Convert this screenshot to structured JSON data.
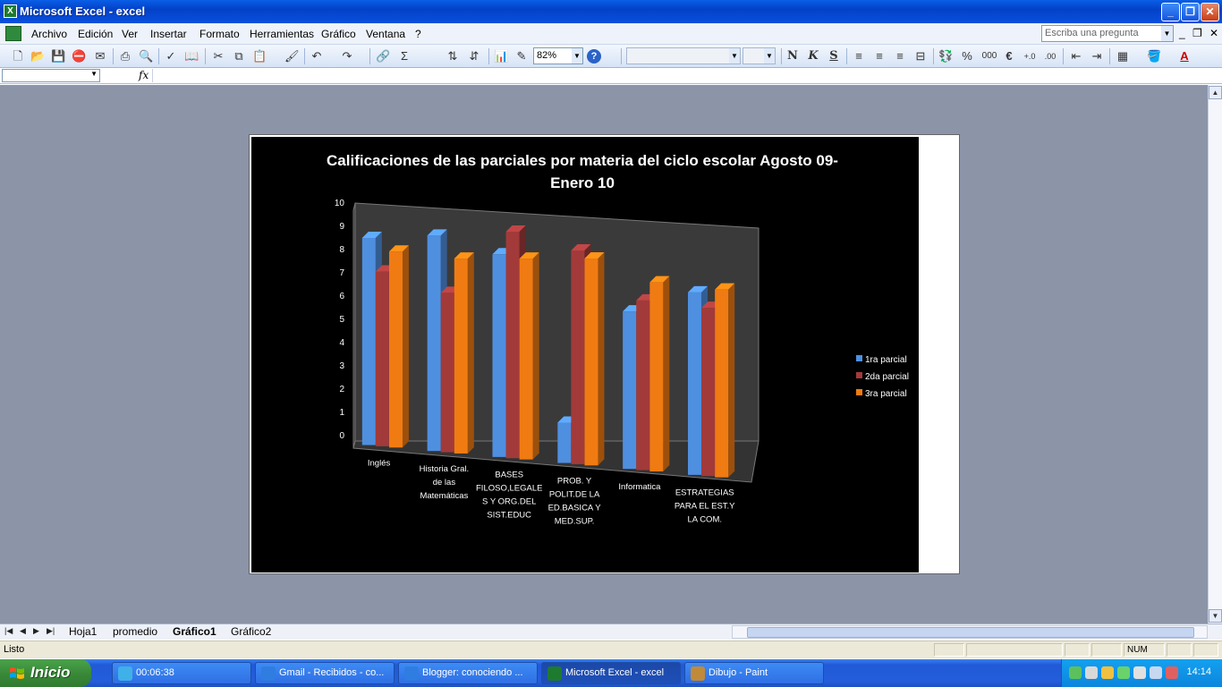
{
  "window": {
    "title": "Microsoft Excel - excel",
    "app_icon_letter": "X"
  },
  "menubar": {
    "items": [
      "Archivo",
      "Edición",
      "Ver",
      "Insertar",
      "Formato",
      "Herramientas",
      "Gráfico",
      "Ventana",
      "?"
    ],
    "ask_placeholder": "Escriba una pregunta"
  },
  "toolbar": {
    "zoom": "82%",
    "bold_label": "N",
    "italic_label": "K",
    "underline_label": "S",
    "percent_label": "%",
    "thousands_label": "000",
    "euro_label": "€",
    "sum_label": "Σ",
    "help_label": "?"
  },
  "formulabar": {
    "fx_label": "fx",
    "name_value": "",
    "formula_value": ""
  },
  "chart_data": {
    "type": "bar",
    "title": "Calificaciones de las parciales por materia del ciclo escolar Agosto 09- Enero 10",
    "title_lines": [
      "Calificaciones de las parciales por materia del ciclo escolar Agosto 09-",
      "Enero 10"
    ],
    "categories": [
      [
        "Inglés"
      ],
      [
        "Historia Gral.",
        "de las",
        "Matemáticas"
      ],
      [
        "BASES",
        "FILOSO,LEGALE",
        "S Y ORG.DEL",
        "SIST.EDUC"
      ],
      [
        "PROB. Y",
        "POLIT.DE LA",
        "ED.BASICA Y",
        "MED.SUP."
      ],
      [
        "Informatica"
      ],
      [
        "ESTRATEGIAS",
        "PARA EL EST.Y",
        "LA COM."
      ]
    ],
    "series": [
      {
        "name": "1ra parcial",
        "color": "#4f8fe0",
        "values": [
          8.9,
          9.2,
          8.6,
          1.7,
          6.6,
          7.6
        ]
      },
      {
        "name": "2da parcial",
        "color": "#a23a3a",
        "values": [
          7.5,
          6.8,
          9.6,
          9.0,
          7.1,
          7.0
        ]
      },
      {
        "name": "3ra parcial",
        "color": "#f07b12",
        "values": [
          8.4,
          8.3,
          8.5,
          8.7,
          7.9,
          7.8
        ]
      }
    ],
    "yticks": [
      "0",
      "1",
      "2",
      "3",
      "4",
      "5",
      "6",
      "7",
      "8",
      "9",
      "10"
    ],
    "ylim": [
      0,
      10
    ],
    "legend_position": "right",
    "grid": false,
    "style": "3d-clustered-column"
  },
  "sheets": {
    "tabs": [
      "Hoja1",
      "promedio",
      "Gráfico1",
      "Gráfico2"
    ],
    "active": "Gráfico1"
  },
  "statusbar": {
    "text": "Listo",
    "num_indicator": "NUM"
  },
  "taskbar": {
    "start_label": "Inicio",
    "tasks": [
      {
        "label": "00:06:38",
        "color": "#3fb0e8"
      },
      {
        "label": "Gmail - Recibidos - co...",
        "color": "#2f7de0"
      },
      {
        "label": "Blogger: conociendo ...",
        "color": "#2f7de0"
      },
      {
        "label": "Microsoft Excel - excel",
        "color": "#1e7a2f"
      },
      {
        "label": "Dibujo - Paint",
        "color": "#c08a3a"
      }
    ],
    "clock": "14:14"
  }
}
